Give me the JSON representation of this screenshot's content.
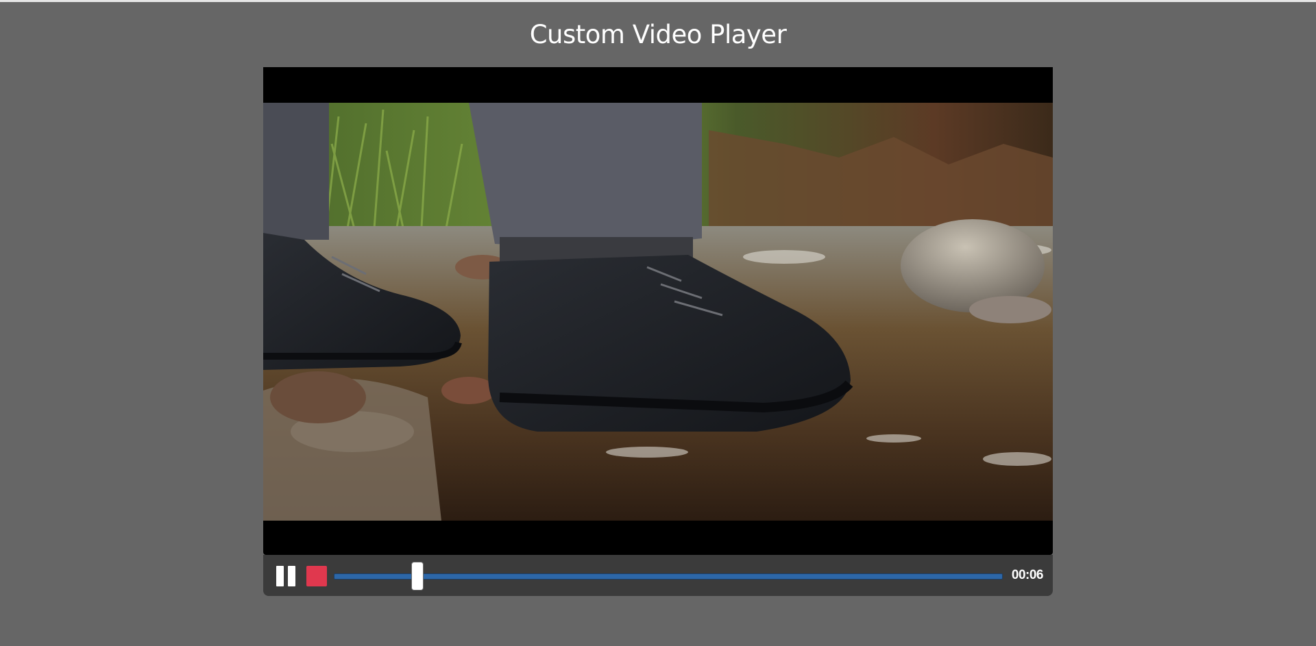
{
  "page": {
    "title": "Custom Video Player"
  },
  "player": {
    "video_description_icon": "video-frame",
    "controls": {
      "pause_icon": "pause-icon",
      "stop_icon": "stop-icon",
      "progress_fraction": 0.125,
      "time": "00:06"
    },
    "colors": {
      "page_background": "#666666",
      "controls_background": "#3b3b3b",
      "progress_fill": "#2d67a8",
      "stop_button": "#e0384e"
    }
  }
}
